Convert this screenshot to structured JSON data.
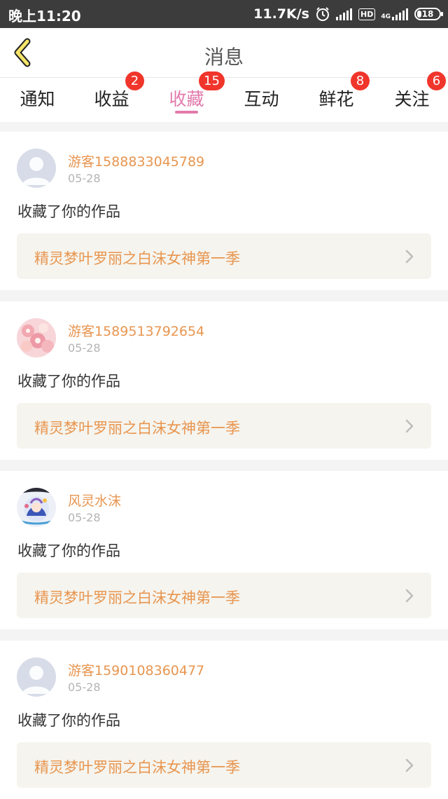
{
  "status_bar": {
    "time": "晚上11:20",
    "net_speed": "11.7K/s",
    "hd": "HD",
    "network_type": "4G",
    "battery": "18"
  },
  "header": {
    "title": "消息",
    "back_icon": "chevron-left-icon"
  },
  "tabs": [
    {
      "label": "通知",
      "badge": ""
    },
    {
      "label": "收益",
      "badge": "2"
    },
    {
      "label": "收藏",
      "badge": "15"
    },
    {
      "label": "互动",
      "badge": ""
    },
    {
      "label": "鲜花",
      "badge": "8"
    },
    {
      "label": "关注",
      "badge": "6"
    }
  ],
  "active_tab": "收藏",
  "colors": {
    "accent": "#e27aab",
    "username": "#e8954f",
    "badge": "#f0352b",
    "work_box_bg": "#f5f4ee"
  },
  "items": [
    {
      "user": "游客1588833045789",
      "date": "05-28",
      "action": "收藏了你的作品",
      "work": "精灵梦叶罗丽之白沫女神第一季",
      "avatar": "default-avatar"
    },
    {
      "user": "游客1589513792654",
      "date": "05-28",
      "action": "收藏了你的作品",
      "work": "精灵梦叶罗丽之白沫女神第一季",
      "avatar": "floral-pink-avatar"
    },
    {
      "user": "风灵水沫",
      "date": "05-28",
      "action": "收藏了你的作品",
      "work": "精灵梦叶罗丽之白沫女神第一季",
      "avatar": "anime-character-avatar"
    },
    {
      "user": "游客1590108360477",
      "date": "05-28",
      "action": "收藏了你的作品",
      "work": "精灵梦叶罗丽之白沫女神第一季",
      "avatar": "default-avatar"
    }
  ]
}
